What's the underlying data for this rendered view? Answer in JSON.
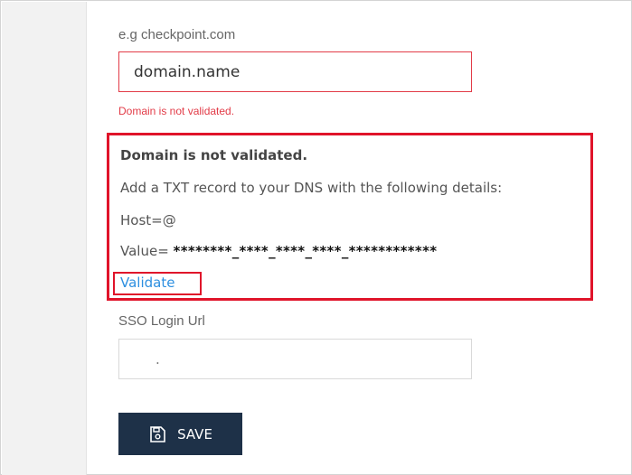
{
  "domain_field": {
    "hint": "e.g checkpoint.com",
    "value": "domain.name",
    "error": "Domain is not validated."
  },
  "validation_box": {
    "title": "Domain is not validated.",
    "instruction": "Add a TXT record to your DNS with the following details:",
    "host": "Host=@",
    "value_label": "Value=",
    "value_masked": "********_****_****_****_************",
    "validate_link": "Validate"
  },
  "sso_field": {
    "label": "SSO Login Url",
    "value": "."
  },
  "save_button": {
    "label": "SAVE",
    "icon": "save-icon"
  },
  "colors": {
    "error": "#e23b47",
    "highlight_border": "#e0142a",
    "link": "#2d8fe0",
    "button_bg": "#1e3148"
  }
}
